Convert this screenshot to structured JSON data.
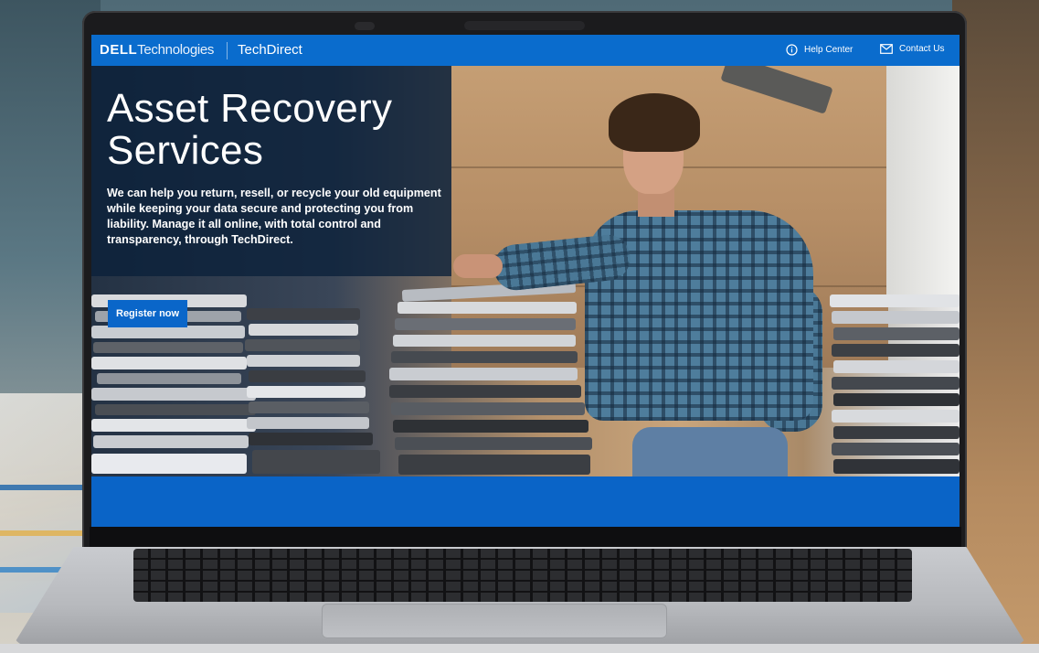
{
  "topbar": {
    "brand_bold": "DELL",
    "brand_rest": "Technologies",
    "product": "TechDirect",
    "help_center": "Help Center",
    "contact_us": "Contact Us"
  },
  "hero": {
    "headline": "Asset Recovery Services",
    "body": "We can help you return, resell, or recycle your old equipment while keeping your data secure and protecting you from liability. Manage it all online, with total control and transparency, through TechDirect.",
    "cta_label": "Register now"
  },
  "colors": {
    "brand_blue": "#0a6ccd",
    "overlay": "#0a203a",
    "cta": "#0a66c9"
  },
  "icons": {
    "help": "info-circle-icon",
    "contact": "mail-icon"
  }
}
